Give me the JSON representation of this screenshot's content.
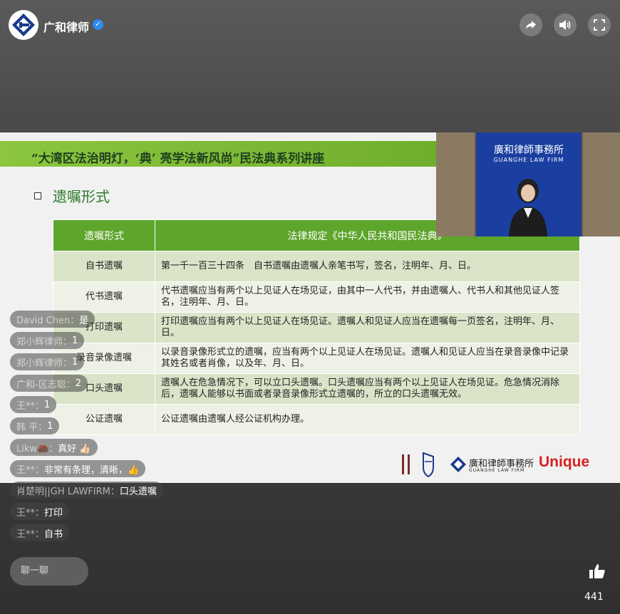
{
  "channel": {
    "name": "广和律师",
    "verified_icon": "verified-badge-icon"
  },
  "top_buttons": [
    "share-icon",
    "volume-icon",
    "fullscreen-icon"
  ],
  "slide": {
    "title": "“大湾区法治明灯，‘典’ 亮学法新风尚”民法典系列讲座",
    "section": "遗嘱形式",
    "table": {
      "headers": [
        "遗嘱形式",
        "法律规定《中华人民共和国民法典》"
      ],
      "rows": [
        {
          "type": "自书遗嘱",
          "rule": "第一千一百三十四条　自书遗嘱由遗嘱人亲笔书写，签名，注明年、月、日。"
        },
        {
          "type": "代书遗嘱",
          "rule": "代书遗嘱应当有两个以上见证人在场见证，由其中一人代书，并由遗嘱人、代书人和其他见证人签名，注明年、月、日。"
        },
        {
          "type": "打印遗嘱",
          "rule": "打印遗嘱应当有两个以上见证人在场见证。遗嘱人和见证人应当在遗嘱每一页签名，注明年、月、日。"
        },
        {
          "type": "录音录像遗嘱",
          "rule": "以录音录像形式立的遗嘱，应当有两个以上见证人在场见证。遗嘱人和见证人应当在录音录像中记录其姓名或者肖像，以及年、月、日。"
        },
        {
          "type": "口头遗嘱",
          "rule": "遗嘱人在危急情况下，可以立口头遗嘱。口头遗嘱应当有两个以上见证人在场见证。危急情况消除后，遗嘱人能够以书面或者录音录像形式立遗嘱的，所立的口头遗嘱无效。"
        },
        {
          "type": "公证遗嘱",
          "rule": "公证遗嘱由遗嘱人经公证机构办理。"
        }
      ]
    },
    "footer_logos": {
      "firm_cn": "廣和律師事務所",
      "firm_en": "GUANGHE LAW FIRM",
      "brand": "Unique"
    }
  },
  "pip": {
    "banner_cn": "廣和律師事務所",
    "banner_en": "GUANGHE LAW FIRM"
  },
  "chat": [
    {
      "user": "David Chen：",
      "text": "是"
    },
    {
      "user": "郑小辉律师：",
      "text": "1"
    },
    {
      "user": "郑小辉律师：",
      "text": "1"
    },
    {
      "user": "广和-区志聪：",
      "text": "2"
    },
    {
      "user": "王**：",
      "text": "1"
    },
    {
      "user": "韩 平：",
      "text": "1"
    },
    {
      "user": "Likw🌰：",
      "text": "真好 👍🏻"
    },
    {
      "user": "王**：",
      "text": "非常有条理，清晰，👍"
    },
    {
      "user": "肖楚明||GH LAWFIRM：",
      "text": "口头遗嘱"
    },
    {
      "user": "王**：",
      "text": "打印"
    },
    {
      "user": "王**：",
      "text": "自书"
    }
  ],
  "chat_input": {
    "placeholder": "聊一聊"
  },
  "likes": {
    "icon": "thumbs-up-icon",
    "count": "441"
  }
}
